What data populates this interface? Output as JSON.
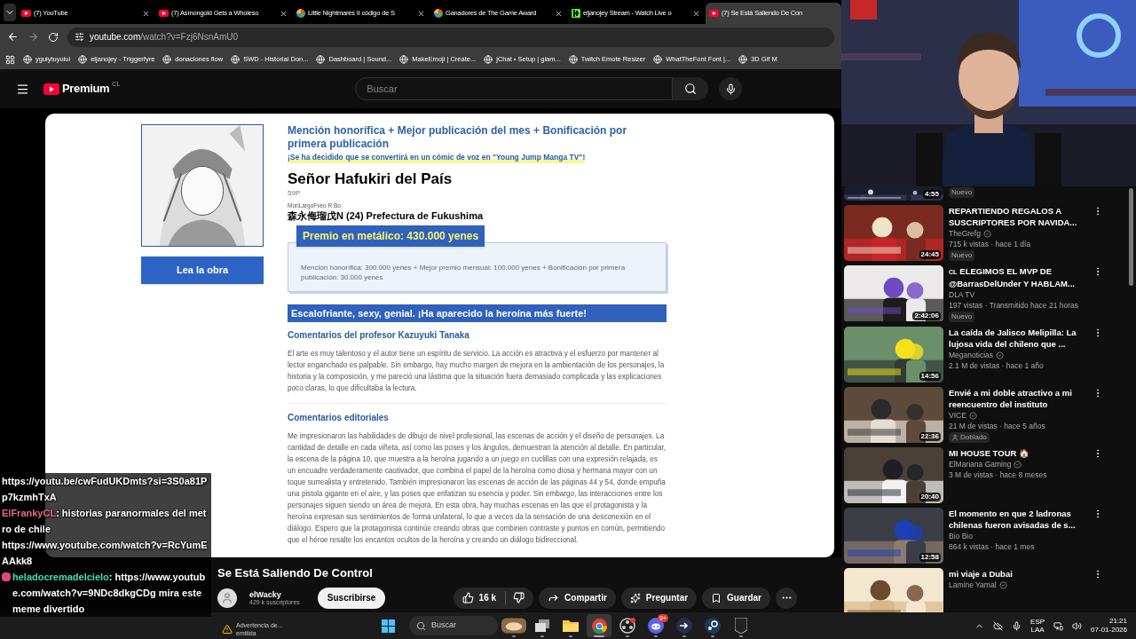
{
  "browser": {
    "tabs": [
      {
        "title": "(7) YouTube",
        "kind": "youtube",
        "selected": false
      },
      {
        "title": "(7) Asmongold Gets a Wholeso",
        "kind": "youtube",
        "selected": false
      },
      {
        "title": "Little Nightmares II código de S",
        "kind": "pinwheel",
        "selected": false
      },
      {
        "title": "Ganadores de The Game Award",
        "kind": "pinwheel",
        "selected": false
      },
      {
        "title": "eljanojey Stream - Watch Live o",
        "kind": "kick",
        "selected": false
      },
      {
        "title": "(7) Se Está Saliendo De Con",
        "kind": "youtube",
        "selected": true
      }
    ],
    "address": {
      "host": "youtube.com",
      "path": "/watch?v=Fzj6NsnAmU0"
    },
    "bookmarks": [
      "yguiytuyuiui",
      "eljanojey - Triggerfyre",
      "donaciones flow",
      "SWD - Historial Don...",
      "Dashboard | Sound...",
      "MakeEmoji | Create...",
      "jChat • Setup | giam...",
      "Twitch Emote Resizer",
      "WhatTheFont Font |...",
      "3D Gif M"
    ]
  },
  "youtube": {
    "logo": "Premium",
    "region": "CL",
    "search_placeholder": "Buscar",
    "page": {
      "read_button": "Lea la obra",
      "award": "Mención honorífica + Mejor publicación del mes + Bonificación por primera publicación",
      "announcement": "¡Se ha decidido que se convertirá en un cómic de voz en \"Young Jump Manga TV\"!",
      "work_title": "Señor Hafukiri del País",
      "pages": "59P",
      "furigana": "MoriLargoFveo R Bo",
      "author": "森永侮瑠戊N (24) Prefectura de Fukushima",
      "prize_label": "Premio en metálico: 430.000 yenes",
      "prize_detail": "Mención honorífica: 300.000 yenes + Mejor premio mensual: 100.000 yenes + Bonificación por primera publicación: 30.000 yenes",
      "tagline": "Escalofriante, sexy, genial. ¡Ha aparecido la heroína más fuerte!",
      "sections": [
        {
          "heading": "Comentarios del profesor Kazuyuki Tanaka",
          "body": "El arte es muy talentoso y el autor tiene un espíritu de servicio. La acción es atractiva y el esfuerzo por mantener al lector enganchado es palpable. Sin embargo, hay mucho margen de mejora en la ambientación de los personajes, la historia y la composición, y me pareció una lástima que la situación fuera demasiado complicada y las explicaciones poco claras, lo que dificultaba la lectura."
        },
        {
          "heading": "Comentarios editoriales",
          "body": "Me impresionaron las habilidades de dibujo de nivel profesional, las escenas de acción y el diseño de personajes. La cantidad de detalle en cada viñeta, así como las poses y los ángulos, demuestran la atención al detalle. En particular, la escena de la página 10, que muestra a la heroína jugando a un juego en cuclillas con una expresión relajada, es un encuadre verdaderamente cautivador, que combina el papel de la heroína como diosa y hermana mayor con un toque surrealista y entretenido. También impresionaron las escenas de acción de las páginas 44 y 54, donde empuña una pistola gigante en el aire, y las poses que enfatizan su esencia y poder. Sin embargo, las interacciones entre los personajes siguen siendo un área de mejora. En esta obra, hay muchas escenas en las que el protagonista y la heroína expresan sus sentimientos de forma unilateral, lo que a veces da la sensación de una desconexión en el diálogo. Espero que la protagonista continúe creando obras que combinen contraste y puntos en común, permitiendo que el héroe resalte los encantos ocultos de la heroína y creando un diálogo bidireccional."
        }
      ]
    },
    "video": {
      "title": "Se Está Saliendo De Control",
      "channel": "elWacky",
      "subscribers": "429 k suscriptores",
      "subscribe": "Suscribirse",
      "likes": "16 k",
      "share": "Compartir",
      "ask": "Preguntar",
      "save": "Guardar"
    },
    "related": [
      {
        "duration": "4:55",
        "tag": {
          "kind": "new",
          "label": "Nuevo"
        }
      },
      {
        "title": "REPARTIENDO REGALOS A SUSCRIPTORES POR NAVIDA...",
        "channel": "TheGrefg",
        "verified": true,
        "meta": "715 k vistas · hace 1 día",
        "duration": "24:45",
        "tag": {
          "kind": "new",
          "label": "Nuevo"
        }
      },
      {
        "prefix": "CL",
        "title": "ELEGIMOS EL MVP DE @BarrasDelUnder Y HABLAM...",
        "channel": "DLA TV",
        "verified": false,
        "meta": "197 vistas · Transmitido hace 21 horas",
        "duration": "2:42:06",
        "tag": {
          "kind": "new",
          "label": "Nuevo"
        }
      },
      {
        "title": "La caída de Jalisco Melipilla: La lujosa vida del chileno que ...",
        "channel": "Meganoticias",
        "verified": true,
        "meta": "2.1 M de vistas · hace 1 año",
        "duration": "14:56"
      },
      {
        "title": "Envié a mi doble atractivo a mi reencuentro del instituto",
        "channel": "VICE",
        "verified": true,
        "meta": "21 M de vistas · hace 5 años",
        "duration": "22:36",
        "tag": {
          "kind": "dubbed",
          "label": "Doblado"
        }
      },
      {
        "title": "MI HOUSE TOUR 🏠",
        "channel": "ElMariana Gaming",
        "verified": true,
        "meta": "3 M de vistas · hace 8 meses",
        "duration": "20:40"
      },
      {
        "title": "El momento en que 2 ladronas chilenas fueron avisadas de s...",
        "channel": "Bio Bio",
        "verified": false,
        "meta": "864 k vistas · hace 1 mes",
        "duration": "12:58"
      },
      {
        "title": "mi viaje a Dubai",
        "channel": "Lamine Yamal",
        "verified": true
      }
    ]
  },
  "chat": [
    {
      "text": "https://youtu.be/cwFudUKDmts?si=3S0a81Pp7kzmhTxA"
    },
    {
      "user": "ElFrankyCL",
      "color": "#e56a8a",
      "badge": false,
      "text": ": historias paranormales del metro de chile"
    },
    {
      "text": "https://www.youtube.com/watch?v=RcYumEAAkk8"
    },
    {
      "user": "heladocremadelcielo",
      "color": "#3ee0b4",
      "badge": true,
      "text": ": https://www.youtube.com/watch?v=9NDc8dkgCDg mira este meme divertido"
    }
  ],
  "notification": {
    "title": "Advertencia de...",
    "subtitle": "emitida"
  },
  "taskbar": {
    "search": "Buscar",
    "apps": [
      {
        "kind": "widget",
        "selected": false
      },
      {
        "kind": "taskview",
        "selected": false
      },
      {
        "kind": "folder",
        "selected": false
      },
      {
        "kind": "chrome",
        "selected": true
      },
      {
        "kind": "obs",
        "selected": false
      },
      {
        "kind": "discord",
        "selected": false,
        "badge": "9+"
      },
      {
        "kind": "arrow",
        "selected": false
      },
      {
        "kind": "steam",
        "selected": false
      },
      {
        "kind": "epic",
        "selected": false
      }
    ],
    "language": "ESP",
    "layout": "LAA",
    "time": "21:21",
    "date": "07-01-2026"
  }
}
